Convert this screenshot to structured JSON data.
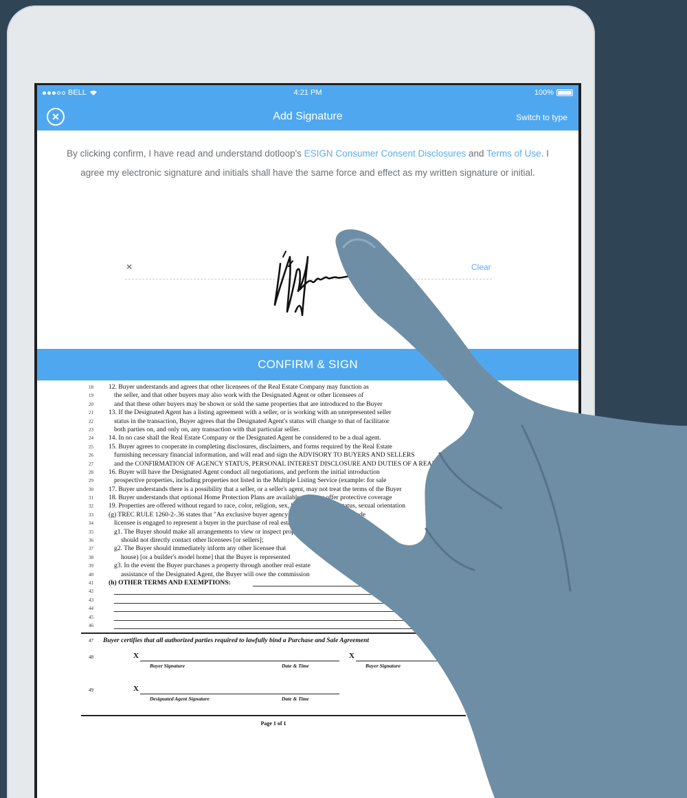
{
  "status_bar": {
    "carrier": "BELL",
    "time": "4:21 PM",
    "battery": "100%"
  },
  "nav": {
    "title": "Add Signature",
    "switch_label": "Switch to type",
    "close_icon": "close-circle-icon"
  },
  "consent": {
    "before": "By clicking confirm, I have read and understand dotloop's ",
    "esign_link": "ESIGN Consumer Consent Disclosures",
    "and": " and ",
    "terms_link": "Terms of Use",
    "after": ". I agree my electronic signature and initials shall have the same force and effect as my written signature or initial."
  },
  "signature_pad": {
    "x_mark": "×",
    "clear_label": "Clear"
  },
  "confirm_button": "CONFIRM & SIGN",
  "document": {
    "lines": [
      {
        "n": "18",
        "t": "12. Buyer understands and agrees that other licensees of the Real Estate Company may function as",
        "cls": ""
      },
      {
        "n": "19",
        "t": "the seller, and that other buyers may also work with the Designated Agent or other licensees of",
        "cls": "ind"
      },
      {
        "n": "20",
        "t": "and that these other buyers may be shown or sold the same properties that are introduced to the Buyer",
        "cls": "ind"
      },
      {
        "n": "21",
        "t": "13. If the Designated Agent has a listing agreement with a seller, or is working with an unrepresented seller",
        "cls": ""
      },
      {
        "n": "22",
        "t": "status in the transaction, Buyer agrees that the Designated Agent's status will change to that of facilitator",
        "cls": "ind"
      },
      {
        "n": "23",
        "t": "both parties on, and only on, any transaction with that particular seller.",
        "cls": "ind"
      },
      {
        "n": "24",
        "t": "14. In no case shall the Real Estate Company or the Designated Agent be considered to be a dual agent.",
        "cls": ""
      },
      {
        "n": "25",
        "t": "15. Buyer agrees to cooperate in completing disclosures, disclaimers, and forms required by the Real Estate",
        "cls": ""
      },
      {
        "n": "26",
        "t": "furnishing necessary financial information, and will read and sign the ADVISORY TO BUYERS AND SELLERS",
        "cls": "ind"
      },
      {
        "n": "27",
        "t": "and the CONFIRMATION OF AGENCY STATUS, PERSONAL INTEREST DISCLOSURE AND DUTIES OF A REAL",
        "cls": "ind"
      },
      {
        "n": "28",
        "t": "16. Buyer will have the Designated Agent conduct all negotiations, and perform the initial introduction",
        "cls": ""
      },
      {
        "n": "29",
        "t": "prospective properties, including properties not listed in the Multiple Listing Service (example: for sale",
        "cls": "ind"
      },
      {
        "n": "30",
        "t": "17. Buyer understands there is a possibility that a seller, or a seller's agent, may not treat the terms of the Buyer",
        "cls": ""
      },
      {
        "n": "31",
        "t": "18. Buyer understands that optional Home Protection Plans are available and may offer protective coverage",
        "cls": ""
      },
      {
        "n": "32",
        "t": "19. Properties are offered without regard to race, color, religion, sex, handicap, familial status, sexual orientation",
        "cls": ""
      },
      {
        "n": "33",
        "t": "(g) TREC RULE 1260-2-.36 states that \"An exclusive buyer agency agreement shall not preclude",
        "cls": ""
      },
      {
        "n": "34",
        "t": "licensee is engaged to represent a buyer in the purchase of real estate",
        "cls": "ind"
      },
      {
        "n": "35",
        "t": "g1. The Buyer should make all arrangements to view or inspect properties",
        "cls": "ind"
      },
      {
        "n": "36",
        "t": "should not directly contact other licensees [or sellers];",
        "cls": "ind2"
      },
      {
        "n": "37",
        "t": "g2. The Buyer should immediately inform any other licensee that",
        "cls": "ind"
      },
      {
        "n": "38",
        "t": "house) [or a builder's model home] that the Buyer is represented",
        "cls": "ind2"
      },
      {
        "n": "39",
        "t": "g3. In the event the Buyer purchases a property through another real estate",
        "cls": "ind"
      },
      {
        "n": "40",
        "t": "assistance of the Designated Agent, the Buyer will owe the commission",
        "cls": "ind2"
      }
    ],
    "other_terms_num": "41",
    "other_terms": "(h) OTHER TERMS AND EXEMPTIONS:",
    "blank_lines": [
      "42",
      "43",
      "44",
      "45",
      "46"
    ],
    "cert_num": "47",
    "certification": "Buyer certifies that all authorized parties required to lawfully bind a Purchase and Sale Agreement",
    "sig_row1_num": "48",
    "sig_row2_num": "49",
    "x_mark": "X",
    "buyer_signature": "Buyer Signature",
    "date_time": "Date & Time",
    "designated_agent_signature": "Designated Agent Signature",
    "page_label": "Page 1 of 1"
  },
  "colors": {
    "background": "#2f4556",
    "accent": "#4fa8ef",
    "hand": "#6e8ea6"
  }
}
